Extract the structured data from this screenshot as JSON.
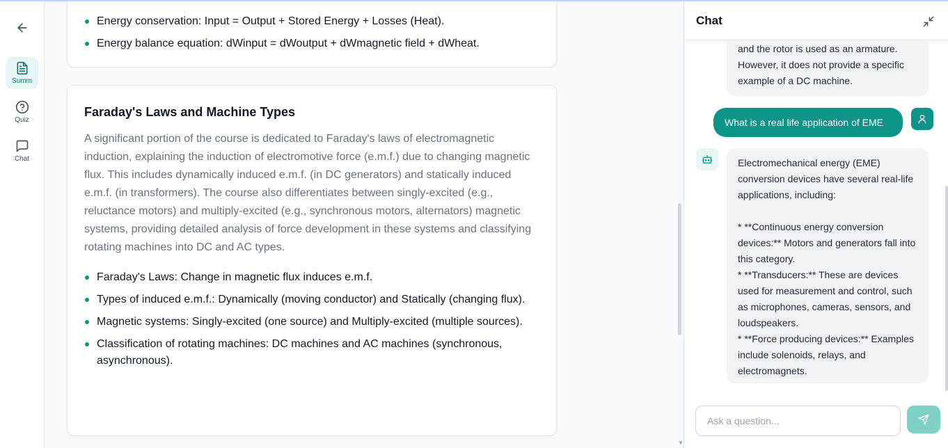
{
  "colors": {
    "accent": "#0d9488",
    "accent_light": "#e7f6f4",
    "send_disabled": "#7fd1c6"
  },
  "nav": {
    "back_icon": "arrow-left-icon",
    "items": [
      {
        "label": "Summ",
        "icon": "document-icon",
        "active": true
      },
      {
        "label": "Quiz",
        "icon": "help-circle-icon",
        "active": false
      },
      {
        "label": "Chat",
        "icon": "chat-bubble-icon",
        "active": false
      }
    ]
  },
  "summary": {
    "section1": {
      "bullets": [
        "Energy conservation: Input = Output + Stored Energy + Losses (Heat).",
        "Energy balance equation: dWinput = dWoutput + dWmagnetic field + dWheat."
      ]
    },
    "section2": {
      "title": "Faraday's Laws and Machine Types",
      "paragraph": "A significant portion of the course is dedicated to Faraday's laws of electromagnetic induction, explaining the induction of electromotive force (e.m.f.) due to changing magnetic flux. This includes dynamically induced e.m.f. (in DC generators) and statically induced e.m.f. (in transformers). The course also differentiates between singly-excited (e.g., reluctance motors) and multiply-excited (e.g., synchronous motors, alternators) magnetic systems, providing detailed analysis of force development in these systems and classifying rotating machines into DC and AC types.",
      "bullets": [
        "Faraday's Laws: Change in magnetic flux induces e.m.f.",
        "Types of induced e.m.f.: Dynamically (moving conductor) and Statically (changing flux).",
        "Magnetic systems: Singly-excited (one source) and Multiply-excited (multiple sources).",
        "Classification of rotating machines: DC machines and AC machines (synchronous, asynchronous)."
      ]
    }
  },
  "chat": {
    "title": "Chat",
    "messages": {
      "bot1": "and the rotor is used as an armature. However, it does not provide a specific example of a DC machine.",
      "user1": "What is a real life application of EME",
      "bot2": "Electromechanical energy (EME) conversion devices have several real-life applications, including:\n\n*   **Continuous energy conversion devices:** Motors and generators fall into this category.\n*   **Transducers:** These are devices used for measurement and control, such as microphones, cameras, sensors, and loudspeakers.\n*   **Force producing devices:** Examples include solenoids, relays, and electromagnets."
    },
    "input_placeholder": "Ask a question...",
    "input_value": ""
  }
}
